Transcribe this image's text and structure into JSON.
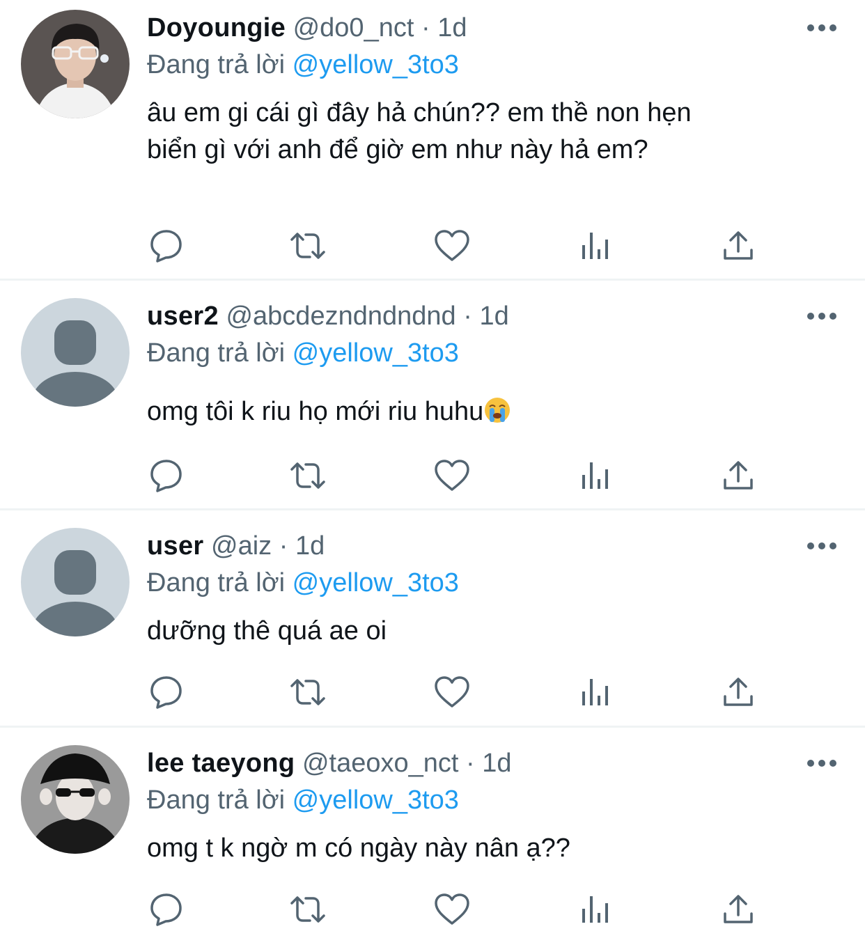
{
  "reply_prefix": "Đang trả lời",
  "colors": {
    "accent": "#1d9bf0",
    "secondary": "#536471",
    "text": "#0f1419"
  },
  "icons": [
    "reply-icon",
    "retweet-icon",
    "like-icon",
    "views-icon",
    "share-icon",
    "more-icon"
  ],
  "tweets": [
    {
      "name": "Doyoungie",
      "handle": "@do0_nct",
      "separator": "·",
      "time": "1d",
      "reply_to": "@yellow_3to3",
      "text_lines": [
        "âu em gi cái gì đây hả chún?? em thề non hẹn",
        "biển gì với anh để giờ em như này hả em?"
      ],
      "avatar": "photo"
    },
    {
      "name": "user2",
      "handle": "@abcdezndndndnd",
      "separator": "·",
      "time": "1d",
      "reply_to": "@yellow_3to3",
      "text_lines": [
        "omg tôi k riu họ mới riu huhu"
      ],
      "trailing_emoji": "crying-face-emoji",
      "avatar": "default"
    },
    {
      "name": "user",
      "handle": "@aiz",
      "separator": "·",
      "time": "1d",
      "reply_to": "@yellow_3to3",
      "text_lines": [
        "dưỡng thê quá ae oi"
      ],
      "avatar": "default"
    },
    {
      "name": "lee taeyong",
      "handle": "@taeoxo_nct",
      "separator": "·",
      "time": "1d",
      "reply_to": "@yellow_3to3",
      "text_lines": [
        "omg t k ngờ m có ngày này nân ạ??"
      ],
      "avatar": "photo"
    }
  ]
}
